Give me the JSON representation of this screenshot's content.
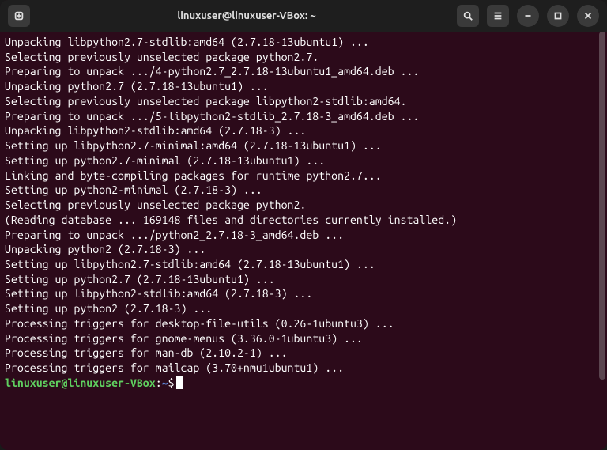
{
  "titlebar": {
    "title": "linuxuser@linuxuser-VBox: ~"
  },
  "terminal": {
    "lines": [
      "Unpacking libpython2.7-stdlib:amd64 (2.7.18-13ubuntu1) ...",
      "Selecting previously unselected package python2.7.",
      "Preparing to unpack .../4-python2.7_2.7.18-13ubuntu1_amd64.deb ...",
      "Unpacking python2.7 (2.7.18-13ubuntu1) ...",
      "Selecting previously unselected package libpython2-stdlib:amd64.",
      "Preparing to unpack .../5-libpython2-stdlib_2.7.18-3_amd64.deb ...",
      "Unpacking libpython2-stdlib:amd64 (2.7.18-3) ...",
      "Setting up libpython2.7-minimal:amd64 (2.7.18-13ubuntu1) ...",
      "Setting up python2.7-minimal (2.7.18-13ubuntu1) ...",
      "Linking and byte-compiling packages for runtime python2.7...",
      "Setting up python2-minimal (2.7.18-3) ...",
      "Selecting previously unselected package python2.",
      "(Reading database ... 169148 files and directories currently installed.)",
      "Preparing to unpack .../python2_2.7.18-3_amd64.deb ...",
      "Unpacking python2 (2.7.18-3) ...",
      "Setting up libpython2.7-stdlib:amd64 (2.7.18-13ubuntu1) ...",
      "Setting up python2.7 (2.7.18-13ubuntu1) ...",
      "Setting up libpython2-stdlib:amd64 (2.7.18-3) ...",
      "Setting up python2 (2.7.18-3) ...",
      "Processing triggers for desktop-file-utils (0.26-1ubuntu3) ...",
      "Processing triggers for gnome-menus (3.36.0-1ubuntu3) ...",
      "Processing triggers for man-db (2.10.2-1) ...",
      "Processing triggers for mailcap (3.70+nmu1ubuntu1) ..."
    ],
    "prompt": {
      "user": "linuxuser",
      "at": "@",
      "host": "linuxuser-VBox",
      "colon": ":",
      "path": "~",
      "dollar": "$"
    }
  }
}
